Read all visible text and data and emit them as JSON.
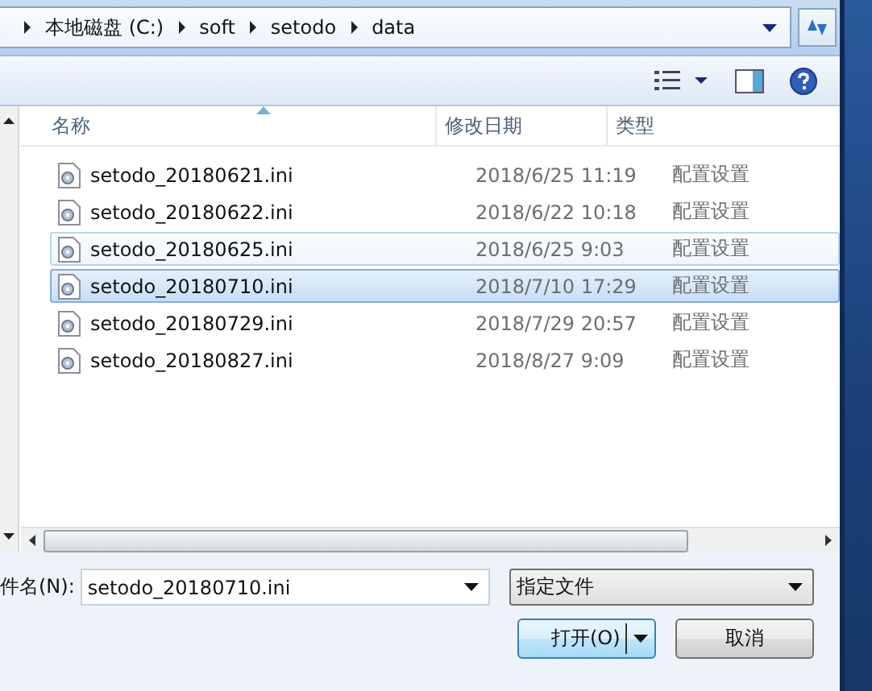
{
  "address_bar": {
    "crumbs": [
      "本地磁盘 (C:)",
      "soft",
      "setodo",
      "data"
    ]
  },
  "columns": [
    {
      "label": "名称",
      "sorted": true
    },
    {
      "label": "修改日期",
      "sorted": false
    },
    {
      "label": "类型",
      "sorted": false
    }
  ],
  "files": [
    {
      "name": "setodo_20180621.ini",
      "modified": "2018/6/25 11:19",
      "type": "配置设置",
      "selected": false,
      "hot": false
    },
    {
      "name": "setodo_20180622.ini",
      "modified": "2018/6/22 10:18",
      "type": "配置设置",
      "selected": false,
      "hot": false
    },
    {
      "name": "setodo_20180625.ini",
      "modified": "2018/6/25 9:03",
      "type": "配置设置",
      "selected": false,
      "hot": true
    },
    {
      "name": "setodo_20180710.ini",
      "modified": "2018/7/10 17:29",
      "type": "配置设置",
      "selected": true,
      "hot": false
    },
    {
      "name": "setodo_20180729.ini",
      "modified": "2018/7/29 20:57",
      "type": "配置设置",
      "selected": false,
      "hot": false
    },
    {
      "name": "setodo_20180827.ini",
      "modified": "2018/8/27 9:09",
      "type": "配置设置",
      "selected": false,
      "hot": false
    }
  ],
  "filename": {
    "label": "件名(N):",
    "value": "setodo_20180710.ini"
  },
  "filter": {
    "value": "指定文件"
  },
  "buttons": [
    {
      "label": "打开(O)",
      "kind": "split"
    },
    {
      "label": "取消",
      "kind": "plain"
    }
  ]
}
